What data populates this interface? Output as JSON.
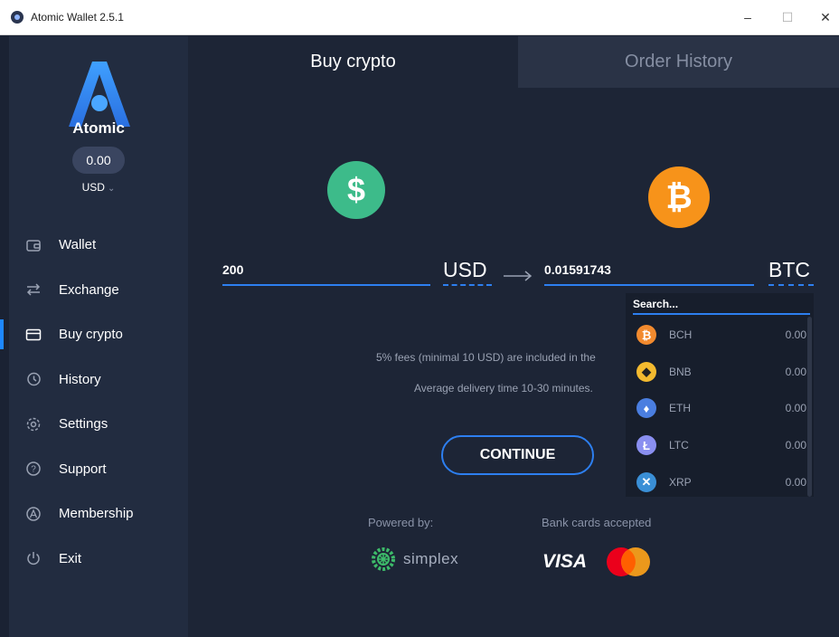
{
  "window": {
    "title": "Atomic Wallet 2.5.1",
    "minimize_glyph": "–",
    "maximize_glyph": "☐",
    "close_glyph": "✕"
  },
  "sidebar": {
    "brand": "Atomic",
    "balance": "0.00",
    "currency": "USD",
    "items": [
      {
        "label": "Wallet",
        "icon": "wallet-icon"
      },
      {
        "label": "Exchange",
        "icon": "exchange-icon"
      },
      {
        "label": "Buy crypto",
        "icon": "buy-card-icon",
        "active": true
      },
      {
        "label": "History",
        "icon": "history-icon"
      },
      {
        "label": "Settings",
        "icon": "settings-icon"
      },
      {
        "label": "Support",
        "icon": "support-icon"
      },
      {
        "label": "Membership",
        "icon": "membership-icon"
      },
      {
        "label": "Exit",
        "icon": "power-icon"
      }
    ]
  },
  "tabs": {
    "buy": "Buy crypto",
    "history": "Order History"
  },
  "buy": {
    "from_symbol": "$",
    "to_symbol": "₿",
    "from_amount": "200",
    "from_unit": "USD",
    "to_amount": "0.01591743",
    "to_unit": "BTC",
    "fees_text": "5% fees (minimal 10 USD) are included in the",
    "delivery_text": "Average delivery time 10-30 minutes.",
    "continue_label": "CONTINUE",
    "powered_label": "Powered by:",
    "provider": "simplex",
    "cards_label": "Bank cards accepted",
    "visa": "VISA"
  },
  "dropdown": {
    "search_placeholder": "Search...",
    "coins": [
      {
        "symbol": "BCH",
        "balance": "0.00",
        "glyph": "₿",
        "color": "#f28a2e"
      },
      {
        "symbol": "BNB",
        "balance": "0.00",
        "glyph": "◆",
        "color": "#f3ba2f"
      },
      {
        "symbol": "ETH",
        "balance": "0.00",
        "glyph": "♦",
        "color": "#4a7ee0"
      },
      {
        "symbol": "LTC",
        "balance": "0.00",
        "glyph": "Ł",
        "color": "#8a8ff0"
      },
      {
        "symbol": "XRP",
        "balance": "0.00",
        "glyph": "✕",
        "color": "#3a8fd6"
      }
    ]
  },
  "colors": {
    "accent": "#2d7ff0",
    "sidebar_bg": "#222c40",
    "main_bg": "#1d2536",
    "usd_coin": "#3dbb8a",
    "btc_coin": "#f7931a"
  }
}
